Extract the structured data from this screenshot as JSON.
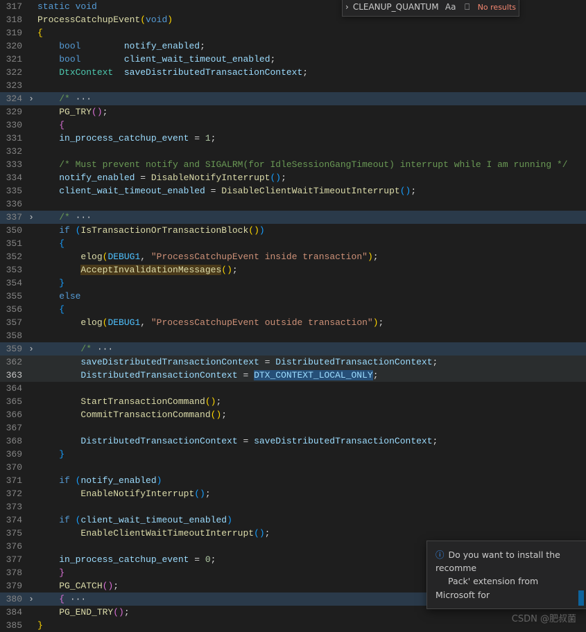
{
  "search": {
    "term": "CLEANUP_QUANTUM",
    "result_text": "No results",
    "case_icon": "Aa",
    "word_icon": "⎕",
    "regex_icon": ".*"
  },
  "toast": {
    "line1": "Do you want to install the recomme",
    "line2": "Pack' extension from Microsoft for "
  },
  "watermark": "CSDN @肥叔菌",
  "code": {
    "l317a": "static",
    "l317b": " void",
    "l318a": "ProcessCatchupEvent",
    "l318b": "(",
    "l318c": "void",
    "l318d": ")",
    "l319": "{",
    "l320a": "    ",
    "l320b": "bool",
    "l320c": "        ",
    "l320d": "notify_enabled",
    "l320e": ";",
    "l321a": "    ",
    "l321b": "bool",
    "l321c": "        ",
    "l321d": "client_wait_timeout_enabled",
    "l321e": ";",
    "l322a": "    ",
    "l322b": "DtxContext",
    "l322c": "  ",
    "l322d": "saveDistributedTransactionContext",
    "l322e": ";",
    "l323": "",
    "l324a": "    ",
    "l324b": "/*",
    "l324c": " ···",
    "l329a": "    ",
    "l329b": "PG_TRY",
    "l329c": "()",
    "l329d": ";",
    "l330a": "    ",
    "l330b": "{",
    "l331a": "    ",
    "l331b": "in_process_catchup_event",
    "l331c": " = ",
    "l331d": "1",
    "l331e": ";",
    "l332": "",
    "l333a": "    ",
    "l333b": "/* Must prevent notify and SIGALRM(for IdleSessionGangTimeout) interrupt while I am running */",
    "l334a": "    ",
    "l334b": "notify_enabled",
    "l334c": " = ",
    "l334d": "DisableNotifyInterrupt",
    "l334e": "()",
    "l334f": ";",
    "l335a": "    ",
    "l335b": "client_wait_timeout_enabled",
    "l335c": " = ",
    "l335d": "DisableClientWaitTimeoutInterrupt",
    "l335e": "()",
    "l335f": ";",
    "l336": "",
    "l337a": "    ",
    "l337b": "/*",
    "l337c": " ···",
    "l350a": "    ",
    "l350b": "if",
    "l350c": " (",
    "l350d": "IsTransactionOrTransactionBlock",
    "l350e": "()",
    "l350f": ")",
    "l351a": "    ",
    "l351b": "{",
    "l352a": "        ",
    "l352b": "elog",
    "l352c": "(",
    "l352d": "DEBUG1",
    "l352e": ", ",
    "l352f": "\"ProcessCatchupEvent inside transaction\"",
    "l352g": ")",
    "l352h": ";",
    "l353a": "        ",
    "l353b": "AcceptInvalidationMessages",
    "l353c": "()",
    "l353d": ";",
    "l354a": "    ",
    "l354b": "}",
    "l355a": "    ",
    "l355b": "else",
    "l356a": "    ",
    "l356b": "{",
    "l357a": "        ",
    "l357b": "elog",
    "l357c": "(",
    "l357d": "DEBUG1",
    "l357e": ", ",
    "l357f": "\"ProcessCatchupEvent outside transaction\"",
    "l357g": ")",
    "l357h": ";",
    "l358": "",
    "l359a": "        ",
    "l359b": "/*",
    "l359c": " ···",
    "l362a": "        ",
    "l362b": "saveDistributedTransactionContext",
    "l362c": " = ",
    "l362d": "DistributedTransactionContext",
    "l362e": ";",
    "l363a": "        ",
    "l363b": "DistributedTransactionContext",
    "l363c": " = ",
    "l363d": "DTX_CONTEXT_LOCAL_ONLY",
    "l363e": ";",
    "l364": "",
    "l365a": "        ",
    "l365b": "StartTransactionCommand",
    "l365c": "()",
    "l365d": ";",
    "l366a": "        ",
    "l366b": "CommitTransactionCommand",
    "l366c": "()",
    "l366d": ";",
    "l367": "",
    "l368a": "        ",
    "l368b": "DistributedTransactionContext",
    "l368c": " = ",
    "l368d": "saveDistributedTransactionContext",
    "l368e": ";",
    "l369a": "    ",
    "l369b": "}",
    "l370": "",
    "l371a": "    ",
    "l371b": "if",
    "l371c": " (",
    "l371d": "notify_enabled",
    "l371e": ")",
    "l372a": "        ",
    "l372b": "EnableNotifyInterrupt",
    "l372c": "()",
    "l372d": ";",
    "l373": "",
    "l374a": "    ",
    "l374b": "if",
    "l374c": " (",
    "l374d": "client_wait_timeout_enabled",
    "l374e": ")",
    "l375a": "        ",
    "l375b": "EnableClientWaitTimeoutInterrupt",
    "l375c": "()",
    "l375d": ";",
    "l376": "",
    "l377a": "    ",
    "l377b": "in_process_catchup_event",
    "l377c": " = ",
    "l377d": "0",
    "l377e": ";",
    "l378a": "    ",
    "l378b": "}",
    "l379a": "    ",
    "l379b": "PG_CATCH",
    "l379c": "()",
    "l379d": ";",
    "l380a": "    ",
    "l380b": "{",
    "l380c": " ···",
    "l384a": "    ",
    "l384b": "PG_END_TRY",
    "l384c": "()",
    "l384d": ";",
    "l385": "}"
  },
  "line_numbers": {
    "317": "317",
    "318": "318",
    "319": "319",
    "320": "320",
    "321": "321",
    "322": "322",
    "323": "323",
    "324": "324",
    "329": "329",
    "330": "330",
    "331": "331",
    "332": "332",
    "333": "333",
    "334": "334",
    "335": "335",
    "336": "336",
    "337": "337",
    "350": "350",
    "351": "351",
    "352": "352",
    "353": "353",
    "354": "354",
    "355": "355",
    "356": "356",
    "357": "357",
    "358": "358",
    "359": "359",
    "362": "362",
    "363": "363",
    "364": "364",
    "365": "365",
    "366": "366",
    "367": "367",
    "368": "368",
    "369": "369",
    "370": "370",
    "371": "371",
    "372": "372",
    "373": "373",
    "374": "374",
    "375": "375",
    "376": "376",
    "377": "377",
    "378": "378",
    "379": "379",
    "380": "380",
    "384": "384",
    "385": "385"
  }
}
